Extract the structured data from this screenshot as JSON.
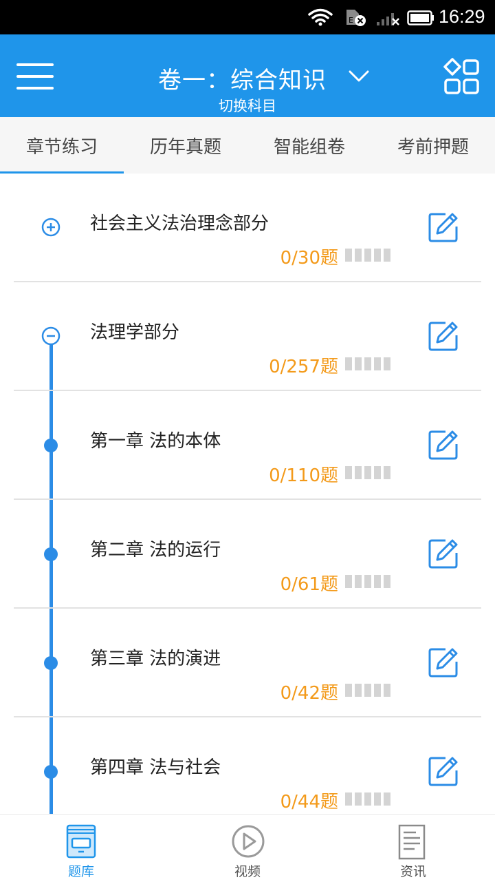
{
  "status": {
    "time": "16:29"
  },
  "header": {
    "title": "卷一：综合知识",
    "subtitle": "切换科目"
  },
  "tabs": [
    {
      "label": "章节练习",
      "active": true
    },
    {
      "label": "历年真题",
      "active": false
    },
    {
      "label": "智能组卷",
      "active": false
    },
    {
      "label": "考前押题",
      "active": false
    }
  ],
  "items": [
    {
      "title": "社会主义法治理念部分",
      "count": "0/30题",
      "node": "expand",
      "progress": 0
    },
    {
      "title": "法理学部分",
      "count": "0/257题",
      "node": "collapse",
      "progress": 0
    },
    {
      "title": "第一章 法的本体",
      "count": "0/110题",
      "node": "dot",
      "progress": 0
    },
    {
      "title": "第二章 法的运行",
      "count": "0/61题",
      "node": "dot",
      "progress": 0
    },
    {
      "title": "第三章 法的演进",
      "count": "0/42题",
      "node": "dot",
      "progress": 0
    },
    {
      "title": "第四章 法与社会",
      "count": "0/44题",
      "node": "dot",
      "progress": 0
    }
  ],
  "bottom_nav": [
    {
      "label": "题库",
      "icon": "question-bank-icon",
      "active": true
    },
    {
      "label": "视频",
      "icon": "play-icon",
      "active": false
    },
    {
      "label": "资讯",
      "icon": "news-icon",
      "active": false
    }
  ],
  "colors": {
    "primary": "#1f95ea",
    "accent_count": "#f39a1a",
    "timeline": "#2b8ce6"
  }
}
